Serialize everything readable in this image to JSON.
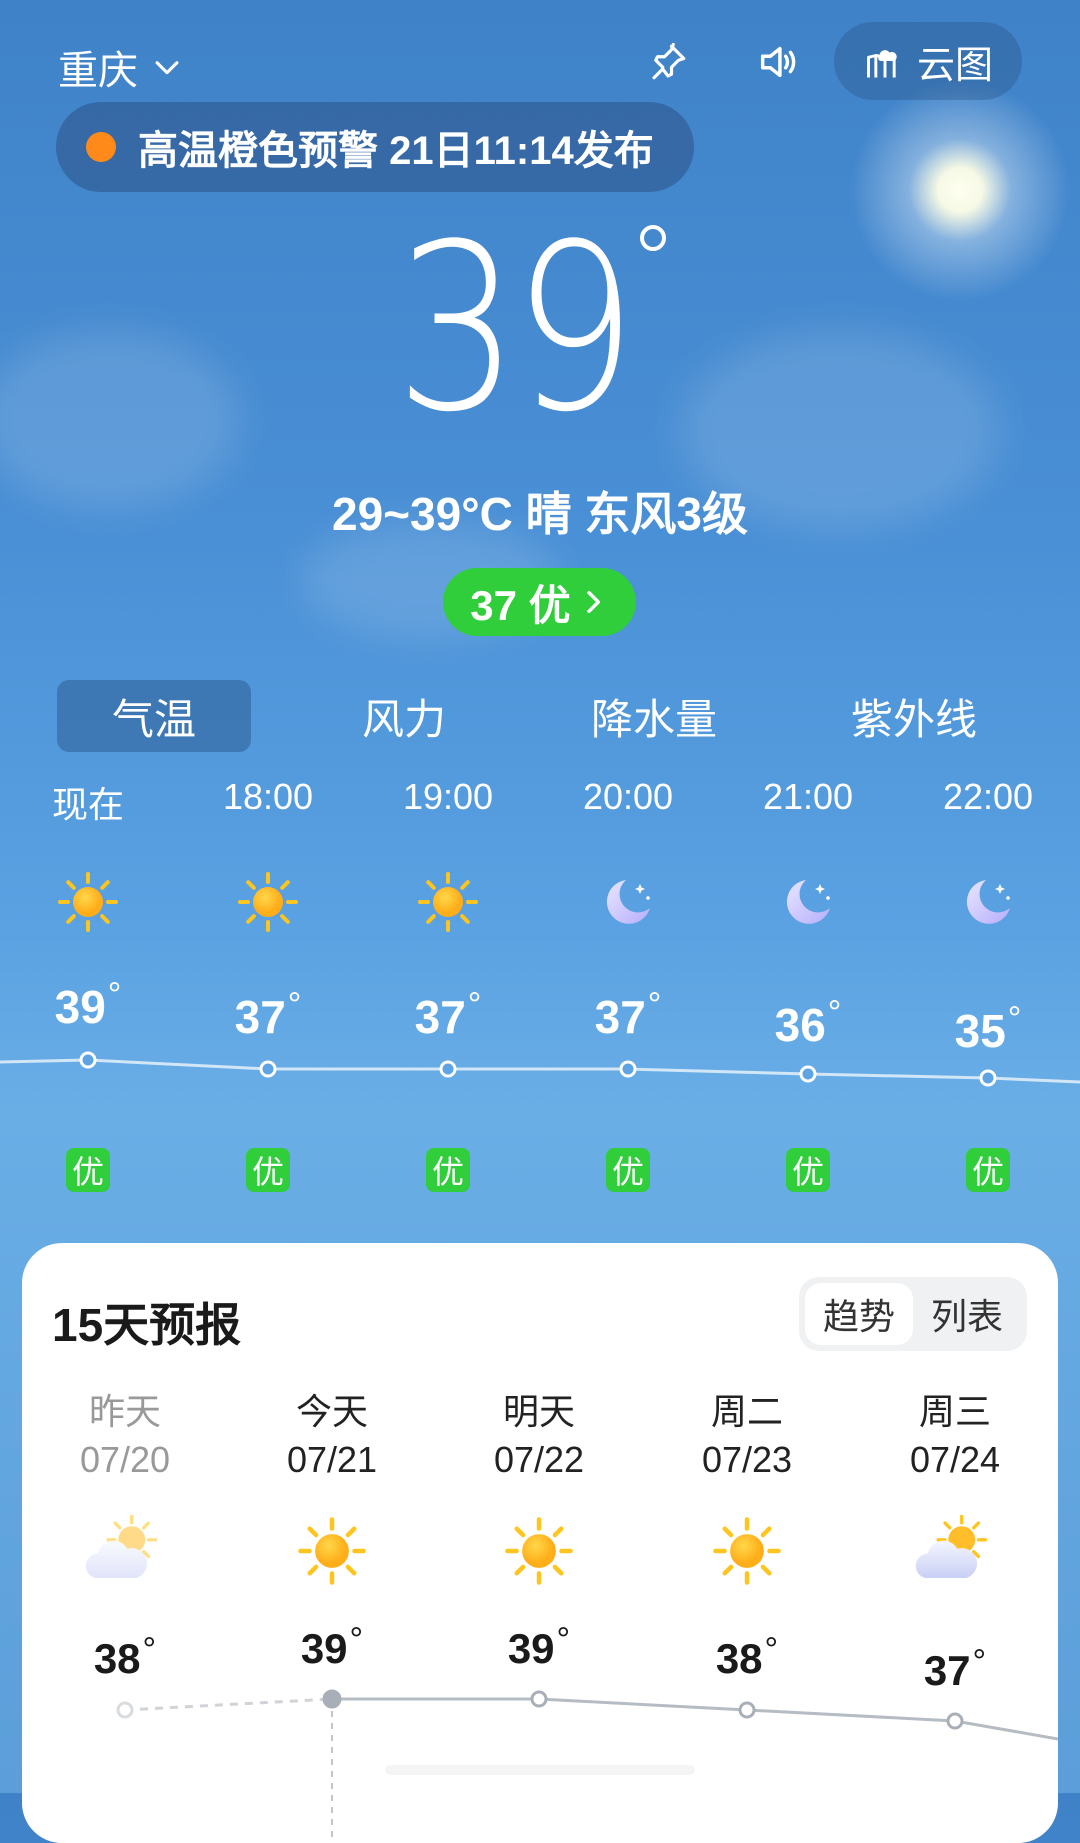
{
  "header": {
    "city": "重庆",
    "cloud_map_label": "云图"
  },
  "warning": {
    "text": "高温橙色预警 21日11:14发布",
    "color": "#ff8a1a"
  },
  "current": {
    "temp": "39",
    "summary": "29~39°C  晴  东风3级",
    "aqi_label": "37 优"
  },
  "tabs": [
    {
      "label": "气温",
      "active": true
    },
    {
      "label": "风力",
      "active": false
    },
    {
      "label": "降水量",
      "active": false
    },
    {
      "label": "紫外线",
      "active": false
    }
  ],
  "hourly": [
    {
      "time": "现在",
      "icon": "sun-icon",
      "temp": "39",
      "aqi": "优"
    },
    {
      "time": "18:00",
      "icon": "sun-icon",
      "temp": "37",
      "aqi": "优"
    },
    {
      "time": "19:00",
      "icon": "sun-icon",
      "temp": "37",
      "aqi": "优"
    },
    {
      "time": "20:00",
      "icon": "moon-icon",
      "temp": "37",
      "aqi": "优"
    },
    {
      "time": "21:00",
      "icon": "moon-icon",
      "temp": "36",
      "aqi": "优"
    },
    {
      "time": "22:00",
      "icon": "moon-icon",
      "temp": "35",
      "aqi": "优"
    }
  ],
  "forecast": {
    "title": "15天预报",
    "toggle": {
      "trend": "趋势",
      "list": "列表",
      "active": "趋势"
    },
    "days": [
      {
        "name": "昨天",
        "date": "07/20",
        "icon": "partly-cloudy-icon",
        "high": "38"
      },
      {
        "name": "今天",
        "date": "07/21",
        "icon": "sun-icon",
        "high": "39"
      },
      {
        "name": "明天",
        "date": "07/22",
        "icon": "sun-icon",
        "high": "39"
      },
      {
        "name": "周二",
        "date": "07/23",
        "icon": "sun-icon",
        "high": "38"
      },
      {
        "name": "周三",
        "date": "07/24",
        "icon": "partly-cloudy-icon",
        "high": "37"
      }
    ]
  },
  "colors": {
    "aqi_good": "#2fce3a",
    "sky_top": "#3f82c8",
    "sky_bottom": "#5b9ed9"
  }
}
